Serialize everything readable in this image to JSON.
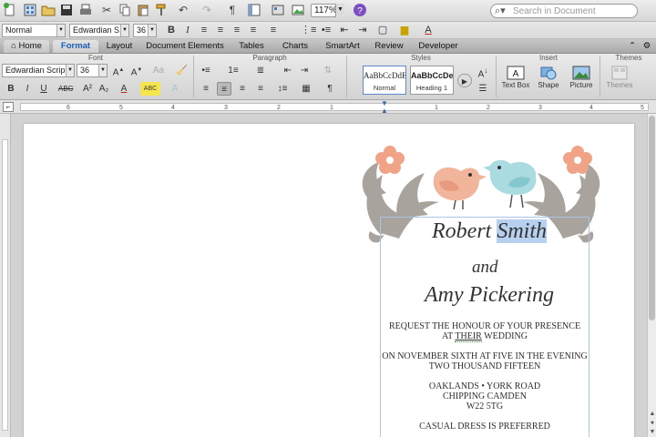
{
  "toolbar": {
    "zoom": "117%",
    "search_placeholder": "Search in Document"
  },
  "format_bar": {
    "style": "Normal",
    "font": "Edwardian S...",
    "size": "36"
  },
  "tabs": [
    "Home",
    "Format",
    "Layout",
    "Document Elements",
    "Tables",
    "Charts",
    "SmartArt",
    "Review",
    "Developer"
  ],
  "ribbon": {
    "groups": {
      "font": "Font",
      "paragraph": "Paragraph",
      "styles": "Styles",
      "insert": "Insert",
      "themes": "Themes"
    },
    "font_name": "Edwardian Scrip...",
    "font_size": "36",
    "styles": [
      {
        "sample": "AaBbCcDdEe",
        "name": "Normal"
      },
      {
        "sample": "AaBbCcDe",
        "name": "Heading 1"
      }
    ],
    "insert": [
      "Text Box",
      "Shape",
      "Picture"
    ],
    "themes_label": "Themes"
  },
  "ruler_numbers": [
    "6",
    "5",
    "4",
    "3",
    "2",
    "1",
    "1",
    "2",
    "3",
    "4",
    "5"
  ],
  "document": {
    "name1_a": "Robert ",
    "name1_b": "Smith",
    "and": "and",
    "name2": "Amy Pickering",
    "line1": "REQUEST THE HONOUR OF YOUR PRESENCE",
    "line2_a": "AT ",
    "line2_b": "THEIR",
    "line2_c": " WEDDING",
    "line3": "ON NOVEMBER SIXTH AT FIVE IN THE EVENING",
    "line4": "TWO THOUSAND FIFTEEN",
    "line5": "OAKLANDS • YORK ROAD",
    "line6": "CHIPPING CAMDEN",
    "line7": "W22 5TG",
    "line8": "CASUAL DRESS IS PREFERRED"
  },
  "colors": {
    "bird_pink": "#f1b59b",
    "bird_blue": "#a9dbe0",
    "leaf_grey": "#a9a39e",
    "flower_pink": "#f0a387",
    "selection": "#b7d0ef",
    "accent_blue": "#1a5fb4"
  }
}
